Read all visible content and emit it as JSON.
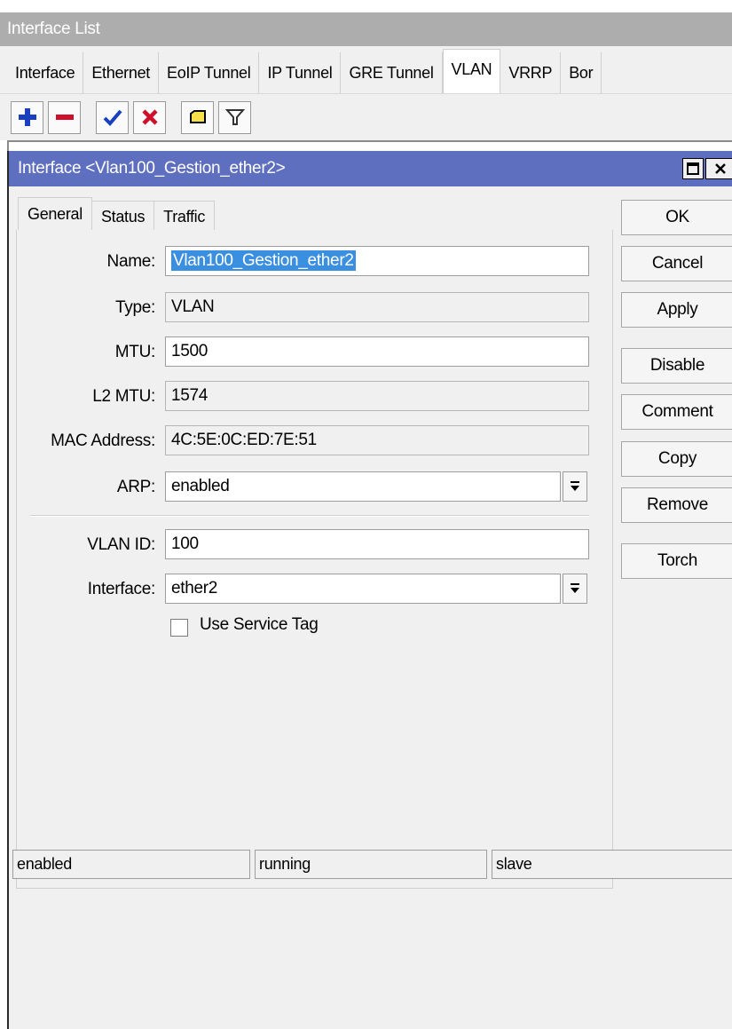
{
  "window": {
    "title": "Interface List"
  },
  "outer_tabs": [
    {
      "label": "Interface",
      "active": false
    },
    {
      "label": "Ethernet",
      "active": false
    },
    {
      "label": "EoIP Tunnel",
      "active": false
    },
    {
      "label": "IP Tunnel",
      "active": false
    },
    {
      "label": "GRE Tunnel",
      "active": false
    },
    {
      "label": "VLAN",
      "active": true
    },
    {
      "label": "VRRP",
      "active": false
    },
    {
      "label": "Bor",
      "active": false
    }
  ],
  "toolbar": {
    "buttons": [
      {
        "icon": "plus-icon",
        "color": "#1a3fbf"
      },
      {
        "icon": "minus-icon",
        "color": "#d0102a"
      },
      {
        "icon": "check-icon",
        "color": "#1a3fbf"
      },
      {
        "icon": "cross-icon",
        "color": "#d0102a"
      },
      {
        "icon": "comment-icon",
        "color": "#f7e04a"
      },
      {
        "icon": "filter-icon",
        "color": "#333333"
      }
    ]
  },
  "dialog": {
    "title": "Interface <Vlan100_Gestion_ether2>",
    "title_color": "#5f6fbf",
    "tabs": [
      {
        "label": "General",
        "active": true
      },
      {
        "label": "Status",
        "active": false
      },
      {
        "label": "Traffic",
        "active": false
      }
    ],
    "fields": {
      "name": {
        "label": "Name:",
        "value": "Vlan100_Gestion_ether2"
      },
      "type": {
        "label": "Type:",
        "value": "VLAN"
      },
      "mtu": {
        "label": "MTU:",
        "value": "1500"
      },
      "l2mtu": {
        "label": "L2 MTU:",
        "value": "1574"
      },
      "mac": {
        "label": "MAC Address:",
        "value": "4C:5E:0C:ED:7E:51"
      },
      "arp": {
        "label": "ARP:",
        "value": "enabled"
      },
      "vlan_id": {
        "label": "VLAN ID:",
        "value": "100"
      },
      "interface": {
        "label": "Interface:",
        "value": "ether2"
      }
    },
    "use_service_tag": {
      "label": "Use Service Tag",
      "checked": false
    },
    "buttons": {
      "ok": "OK",
      "cancel": "Cancel",
      "apply": "Apply",
      "disable": "Disable",
      "comment": "Comment",
      "copy": "Copy",
      "remove": "Remove",
      "torch": "Torch"
    },
    "status_bar": [
      "enabled",
      "running",
      "slave"
    ]
  }
}
